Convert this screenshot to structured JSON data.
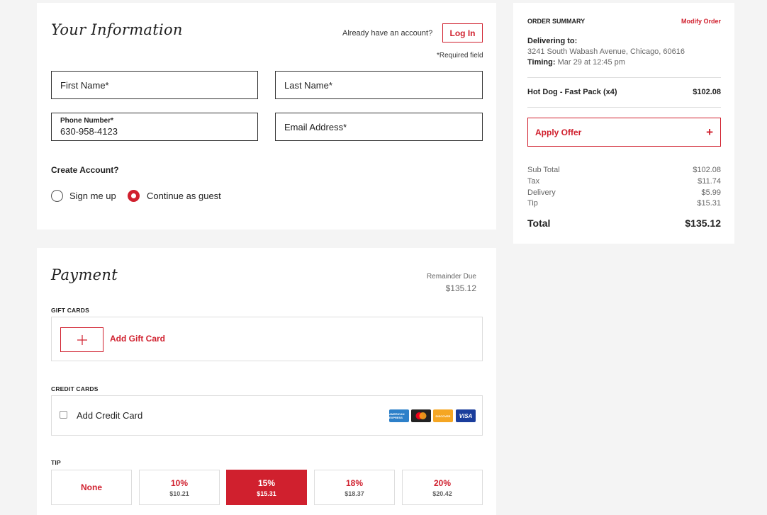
{
  "info": {
    "title": "Your Information",
    "have_account": "Already have an account?",
    "login_label": "Log In",
    "required_note": "*Required field",
    "first_name_placeholder": "First Name*",
    "last_name_placeholder": "Last Name*",
    "phone_label": "Phone Number*",
    "phone_value": "630-958-4123",
    "email_placeholder": "Email Address*",
    "create_account_heading": "Create Account?",
    "options": [
      {
        "label": "Sign me up",
        "selected": false
      },
      {
        "label": "Continue as guest",
        "selected": true
      }
    ]
  },
  "payment": {
    "title": "Payment",
    "remainder_label": "Remainder Due",
    "remainder_value": "$135.12",
    "gift_cards_label": "GIFT CARDS",
    "add_gift_card": "Add Gift Card",
    "credit_cards_label": "CREDIT CARDS",
    "add_credit_card": "Add Credit Card",
    "card_brands": [
      "AMERICAN EXPRESS",
      "",
      "DISCOVER",
      "VISA"
    ],
    "tip_label": "TIP",
    "tips": [
      {
        "pct": "None",
        "amount": ""
      },
      {
        "pct": "10%",
        "amount": "$10.21"
      },
      {
        "pct": "15%",
        "amount": "$15.31",
        "selected": true
      },
      {
        "pct": "18%",
        "amount": "$18.37"
      },
      {
        "pct": "20%",
        "amount": "$20.42"
      }
    ]
  },
  "summary": {
    "title": "ORDER SUMMARY",
    "modify": "Modify Order",
    "delivering_label": "Delivering to:",
    "address": "3241 South Wabash Avenue, Chicago, 60616",
    "timing_label": "Timing:",
    "timing_value": "Mar 29 at 12:45 pm",
    "item_name": "Hot Dog - Fast Pack (x4)",
    "item_price": "$102.08",
    "apply_offer": "Apply Offer",
    "lines": [
      {
        "label": "Sub Total",
        "value": "$102.08"
      },
      {
        "label": "Tax",
        "value": "$11.74"
      },
      {
        "label": "Delivery",
        "value": "$5.99"
      },
      {
        "label": "Tip",
        "value": "$15.31"
      }
    ],
    "total_label": "Total",
    "total_value": "$135.12"
  },
  "colors": {
    "accent": "#d0202e",
    "background": "#f4f4f4"
  }
}
